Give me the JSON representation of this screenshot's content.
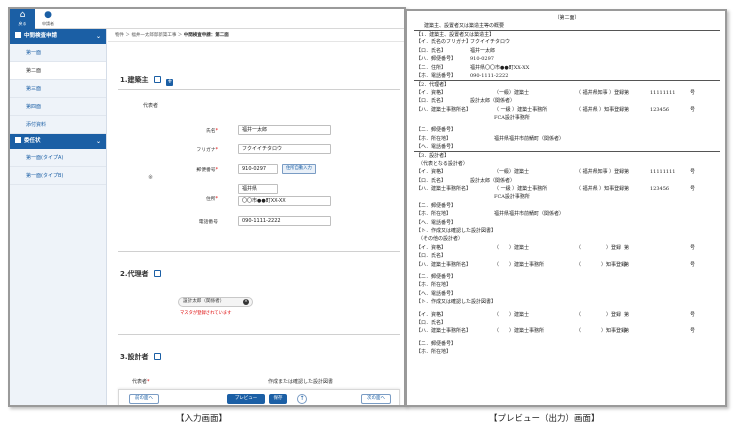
{
  "topbar": {
    "home_label": "戻る",
    "user_label": "申請者"
  },
  "sidebar": {
    "group1": "中間検査申請",
    "items1": [
      "第一面",
      "第二面",
      "第三面",
      "第四面",
      "添付資料"
    ],
    "group2": "委任状",
    "items2": [
      "第一面(タイプA)",
      "第一面(タイプB)"
    ]
  },
  "breadcrumb": {
    "path": "物件 ＞ 福井一太郎邸新築工事 ＞ ",
    "current": "中間検査申請：第二面"
  },
  "section1": {
    "title": "1.建築主",
    "rep_label": "代表者",
    "name_label": "氏名",
    "name_value": "福井一太郎",
    "kana_label": "フリガナ",
    "kana_value": "フクイイチタロウ",
    "zip_label": "郵便番号",
    "zip_value": "910-0297",
    "zip_button": "住所自動入力",
    "address_label": "住所",
    "address_value1": "福井県",
    "address_value2": "〇〇市●●町XX-XX",
    "tel_label": "電話番号",
    "tel_value": "090-1111-2222",
    "marker": "※"
  },
  "section2": {
    "title": "2.代理者",
    "chip": "設計太郎（関係者）",
    "warning": "マスタが登録されています"
  },
  "section3": {
    "title": "3.設計者",
    "col1": "代表者",
    "col2": "作成または確認した設計図書"
  },
  "footer": {
    "prev": "前の面へ",
    "preview": "プレビュー",
    "save": "保存",
    "up": "↑",
    "next": "次の面へ"
  },
  "preview": {
    "page_title": "（第二面）",
    "subtitle": "建築主、設置者又は築造主等の概要",
    "s1": {
      "head": "【1．建築主、設置者又は築造主】",
      "kana_k": "【イ．氏名のフリガナ】",
      "kana_v": "フクイイチタロウ",
      "name_k": "【ロ．氏名】",
      "name_v": "福井一太郎",
      "zip_k": "【ハ．郵便番号】",
      "zip_v": "910-0297",
      "addr_k": "【ニ．住所】",
      "addr_v": "福井県〇〇市●●町XX-XX",
      "tel_k": "【ホ．電話番号】",
      "tel_v": "090-1111-2222"
    },
    "s2": {
      "head": "【2．代理者】",
      "r1_k": "【イ．資格】",
      "r1_a": "（一級）建築士",
      "r1_b": "（ 福井県知事 ）登録",
      "r1_c": "第",
      "r1_d": "11111111",
      "r1_e": "号",
      "r2_k": "【ロ．氏名】",
      "r2_v": "設計太郎（関係者）",
      "r3_k": "【ハ．建築士事務所名】",
      "r3_a": "（ 一級 ）建築士事務所",
      "r3_b": "（ 福井県 ）知事登録",
      "r3_c": "第",
      "r3_d": "123456",
      "r3_e": "号",
      "r3_v2": "FCA設計事務所",
      "r4_k": "【ニ．郵便番号】",
      "r5_k": "【ホ．所在地】",
      "r5_v": "福井県福井市前鯖町（関係者）",
      "r6_k": "【ヘ．電話番号】"
    },
    "s3": {
      "head": "【3．設計者】",
      "sub1": "（代表となる設計者）",
      "r1_k": "【イ．資格】",
      "r1_a": "（一級）建築士",
      "r1_b": "（ 福井県知事 ）登録",
      "r1_c": "第",
      "r1_d": "11111111",
      "r1_e": "号",
      "r2_k": "【ロ．氏名】",
      "r2_v": "設計太郎（関係者）",
      "r3_k": "【ハ．建築士事務所名】",
      "r3_a": "（ 一級 ）建築士事務所",
      "r3_b": "（ 福井県 ）知事登録",
      "r3_c": "第",
      "r3_d": "123456",
      "r3_e": "号",
      "r3_v2": "FCA設計事務所",
      "r4_k": "【ニ．郵便番号】",
      "r5_k": "【ホ．所在地】",
      "r5_v": "福井県福井市前鯖町（関係者）",
      "r6_k": "【ヘ．電話番号】",
      "r7_k": "【ト．作成又は確認した設計図書】",
      "sub2": "（その他の設計者）",
      "o1_k": "【イ．資格】",
      "o1_a": "（　　）建築士",
      "o1_b": "（　　　　　）登録",
      "o1_c": "第",
      "o1_e": "号",
      "o2_k": "【ロ．氏名】",
      "o3_k": "【ハ．建築士事務所名】",
      "o3_a": "（　　）建築士事務所",
      "o3_b": "（　　　　）知事登録",
      "o3_c": "第",
      "o3_e": "号",
      "o4_k": "【ニ．郵便番号】",
      "o5_k": "【ホ．所在地】",
      "o6_k": "【ヘ．電話番号】",
      "o7_k": "【ト．作成又は確認した設計図書】",
      "p1_k": "【イ．資格】",
      "p1_a": "（　　）建築士",
      "p1_b": "（　　　　　）登録",
      "p1_c": "第",
      "p1_e": "号",
      "p2_k": "【ロ．氏名】",
      "p3_k": "【ハ．建築士事務所名】",
      "p3_a": "（　　）建築士事務所",
      "p3_b": "（　　　　）知事登録",
      "p3_c": "第",
      "p3_e": "号",
      "p4_k": "【ニ．郵便番号】",
      "p5_k": "【ホ．所在地】"
    }
  },
  "captions": {
    "left": "【入力画面】",
    "right": "【プレビュー（出力）画面】"
  }
}
